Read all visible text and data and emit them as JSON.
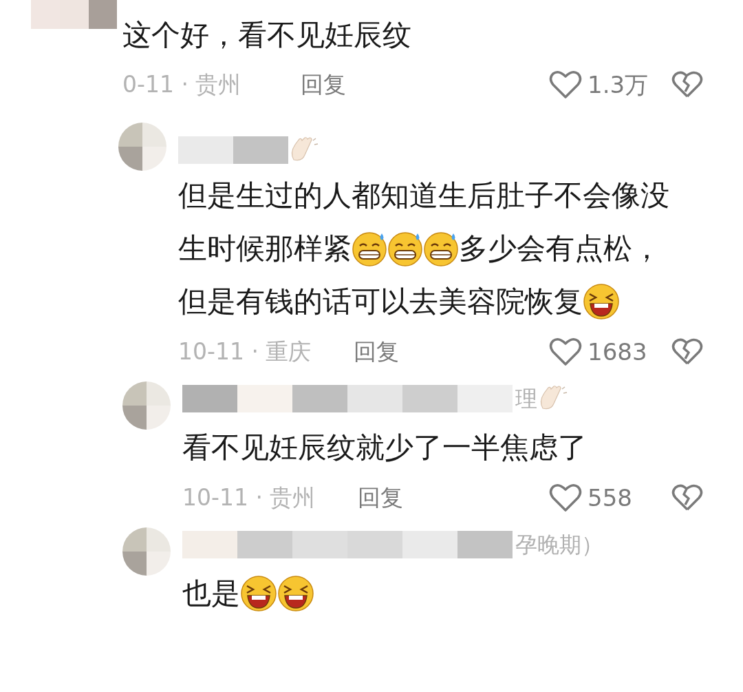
{
  "comments": [
    {
      "kind": "top",
      "lines": [
        [
          {
            "kind": "text",
            "text": "这个好，看不见妊辰纹"
          }
        ]
      ],
      "date_location": "0-11 · 贵州",
      "reply": "回复",
      "likes": "1.3万"
    },
    {
      "kind": "reply",
      "wave": true,
      "lines": [
        [
          {
            "kind": "text",
            "text": "但是生过的人都知道生后肚子不会像没"
          }
        ],
        [
          {
            "kind": "text",
            "text": "生时候那样紧"
          },
          {
            "kind": "grin"
          },
          {
            "kind": "grin"
          },
          {
            "kind": "grin"
          },
          {
            "kind": "text",
            "text": "多少会有点松，"
          }
        ],
        [
          {
            "kind": "text",
            "text": "但是有钱的话可以去美容院恢复"
          },
          {
            "kind": "laugh"
          }
        ]
      ],
      "date_location": "10-11 · 重庆",
      "reply": "回复",
      "likes": "1683"
    },
    {
      "kind": "reply",
      "name_fragment": "理",
      "wave": true,
      "lines": [
        [
          {
            "kind": "text",
            "text": "看不见妊辰纹就少了一半焦虑了"
          }
        ]
      ],
      "date_location": "10-11 · 贵州",
      "reply": "回复",
      "likes": "558"
    },
    {
      "kind": "reply",
      "name_fragment": "孕晚期）",
      "wave": false,
      "lines": [
        [
          {
            "kind": "text",
            "text": "也是"
          },
          {
            "kind": "laugh"
          },
          {
            "kind": "laugh"
          }
        ]
      ]
    }
  ]
}
